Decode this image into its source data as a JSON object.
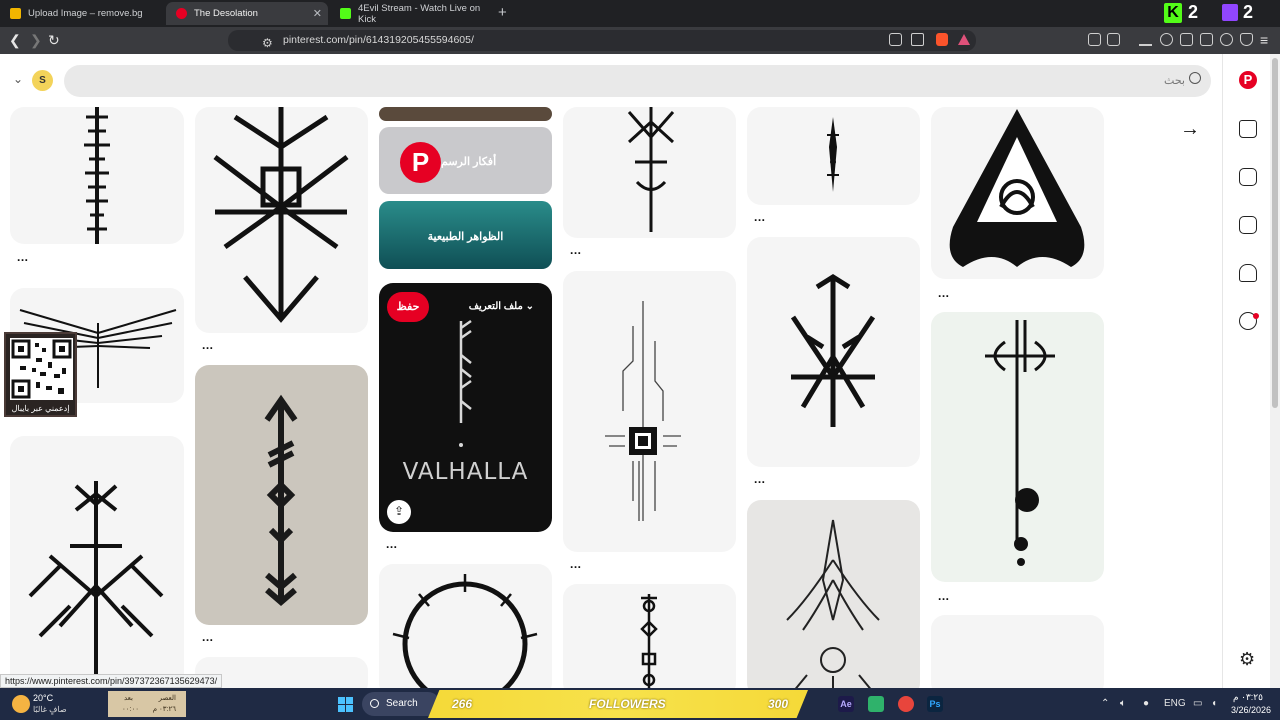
{
  "browser": {
    "tabs": [
      {
        "title": "Upload Image – remove.bg",
        "active": false
      },
      {
        "title": "The Desolation",
        "active": true
      },
      {
        "title": "4Evil Stream - Watch Live on Kick",
        "active": false
      }
    ],
    "kick_count": "2",
    "twitch_count": "2",
    "url": "pinterest.com/pin/614319205455594605/",
    "status_url": "https://www.pinterest.com/pin/397372367135629473/"
  },
  "pinterest": {
    "avatar_letter": "S",
    "search_placeholder": "بحث",
    "logo_letter": "P",
    "idea_drawing": "أفكار الرسم",
    "idea_nature": "الظواهر الطبيعية",
    "save_label": "حفظ",
    "profile_label": "ملف التعريف",
    "valhalla_text": "VALHALLA",
    "more_dots": "...",
    "qr_caption": "إدعمني عبر بايبال"
  },
  "taskbar": {
    "temp": "20°C",
    "weather": "صافٍ غالبًا",
    "prayer_name": "العصر",
    "prayer_after": "بعد",
    "prayer_time": "٠٣:٢٦ م",
    "prayer_remaining": "٠٠:٠٠",
    "search_label": "Search",
    "followers_count": "266",
    "followers_label": "FOLLOWERS",
    "followers_goal": "300",
    "lang": "ENG",
    "time": "٠٣:٢٥ م",
    "date": "3/26/2026"
  }
}
